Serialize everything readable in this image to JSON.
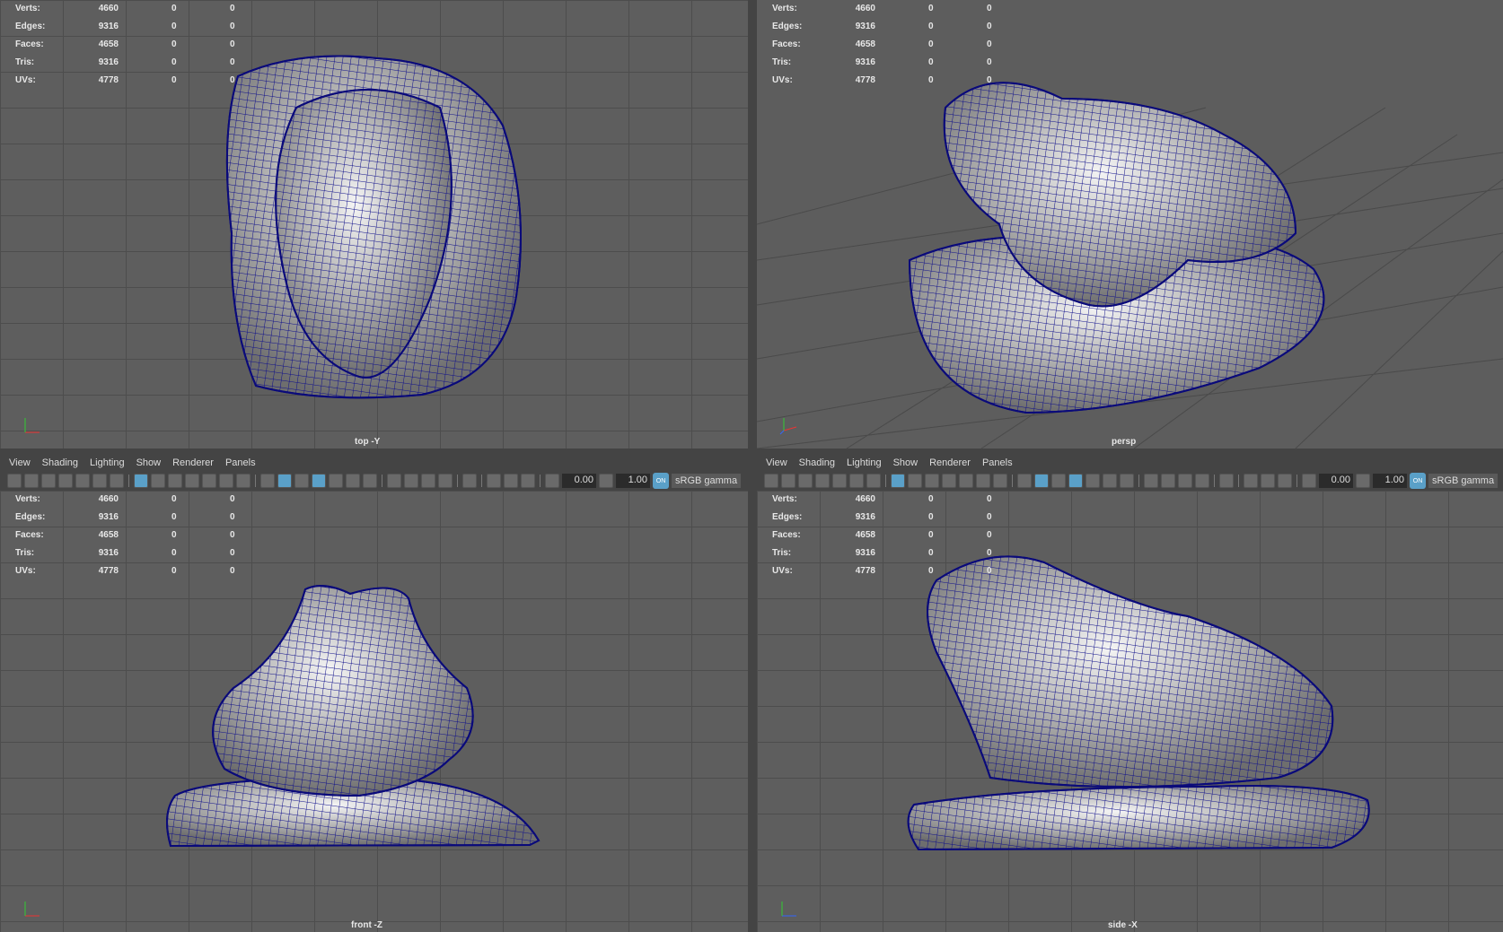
{
  "stats": {
    "rows": [
      {
        "label": "Verts:",
        "value": "4660",
        "a": "0",
        "b": "0"
      },
      {
        "label": "Edges:",
        "value": "9316",
        "a": "0",
        "b": "0"
      },
      {
        "label": "Faces:",
        "value": "4658",
        "a": "0",
        "b": "0"
      },
      {
        "label": "Tris:",
        "value": "9316",
        "a": "0",
        "b": "0"
      },
      {
        "label": "UVs:",
        "value": "4778",
        "a": "0",
        "b": "0"
      }
    ]
  },
  "viewports": {
    "top": "top -Y",
    "persp": "persp",
    "front": "front -Z",
    "side": "side -X"
  },
  "menu": [
    "View",
    "Shading",
    "Lighting",
    "Show",
    "Renderer",
    "Panels"
  ],
  "toolbar": {
    "exposure": "0.00",
    "gamma": "1.00",
    "on_label": "ON",
    "color_space": "sRGB gamma"
  },
  "colors": {
    "wire": "#0a0a8c",
    "active": "#5aa0c8"
  }
}
